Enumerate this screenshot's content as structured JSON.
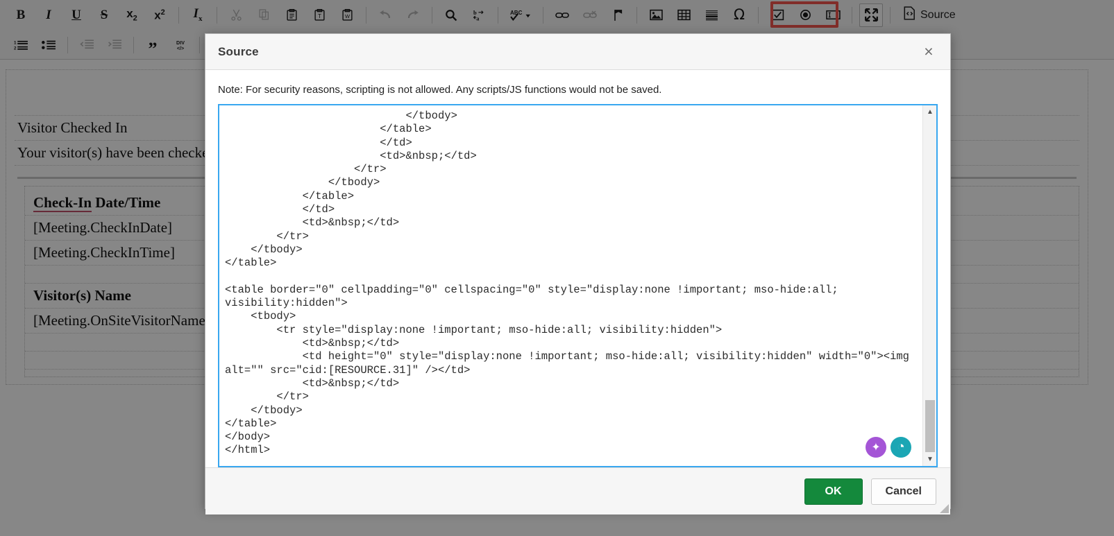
{
  "toolbar": {
    "row1": [
      {
        "name": "bold-icon",
        "glyph": "B",
        "style": "bold-serif",
        "dim": false
      },
      {
        "name": "italic-icon",
        "glyph": "I",
        "style": "italic-serif",
        "dim": false
      },
      {
        "name": "underline-icon",
        "glyph": "U",
        "style": "underline-serif",
        "dim": false
      },
      {
        "name": "strikethrough-icon",
        "glyph": "S",
        "style": "strike-serif",
        "dim": false
      },
      {
        "name": "subscript-icon",
        "glyph": "x₂",
        "style": "plain",
        "dim": false
      },
      {
        "name": "superscript-icon",
        "glyph": "x²",
        "style": "plain",
        "dim": false
      },
      {
        "name": "remove-format-icon",
        "glyph": "Iₓ",
        "style": "italic-serif",
        "dim": false
      },
      {
        "name": "cut-icon",
        "glyph": "✂",
        "style": "plain",
        "dim": true
      },
      {
        "name": "copy-icon",
        "glyph": "❐",
        "style": "plain",
        "dim": true
      },
      {
        "name": "paste-icon",
        "glyph": "Ὄb",
        "style": "plain",
        "dim": false
      },
      {
        "name": "paste-as-text-icon",
        "glyph": "T",
        "style": "boxed",
        "dim": false
      },
      {
        "name": "paste-from-word-icon",
        "glyph": "W",
        "style": "boxed",
        "dim": false
      },
      {
        "name": "undo-icon",
        "glyph": "↶",
        "style": "plain",
        "dim": true
      },
      {
        "name": "redo-icon",
        "glyph": "↷",
        "style": "plain",
        "dim": true
      },
      {
        "name": "find-icon",
        "glyph": "⌕",
        "style": "plain",
        "dim": false
      },
      {
        "name": "replace-icon",
        "glyph": "b→a",
        "style": "plain",
        "dim": false
      },
      {
        "name": "spellcheck-icon",
        "glyph": "ABC✓",
        "style": "plain",
        "dim": false
      },
      {
        "name": "link-icon",
        "glyph": "⚭",
        "style": "plain",
        "dim": false
      },
      {
        "name": "unlink-icon",
        "glyph": "⚭",
        "style": "plain",
        "dim": true
      },
      {
        "name": "anchor-icon",
        "glyph": "⚑",
        "style": "plain",
        "dim": false
      },
      {
        "name": "image-icon",
        "glyph": "Ὓc",
        "style": "plain",
        "dim": false
      },
      {
        "name": "table-icon",
        "glyph": "▦",
        "style": "plain",
        "dim": false
      },
      {
        "name": "horizontal-rule-icon",
        "glyph": "≡",
        "style": "plain",
        "dim": false
      },
      {
        "name": "special-character-icon",
        "glyph": "Ω",
        "style": "plain",
        "dim": false
      },
      {
        "name": "checkbox-icon",
        "glyph": "☑",
        "style": "plain",
        "dim": false
      },
      {
        "name": "radio-button-icon",
        "glyph": "◉",
        "style": "plain",
        "dim": false
      },
      {
        "name": "text-field-icon",
        "glyph": "▢",
        "style": "plain",
        "dim": false
      },
      {
        "name": "maximize-icon",
        "glyph": "⤡",
        "style": "boxed",
        "dim": false
      }
    ],
    "source_button_label": "Source",
    "row2": [
      {
        "name": "numbered-list-icon",
        "glyph": "1.2.",
        "dim": false
      },
      {
        "name": "bulleted-list-icon",
        "glyph": "•≡",
        "dim": false
      },
      {
        "name": "decrease-indent-icon",
        "glyph": "←≡",
        "dim": true
      },
      {
        "name": "increase-indent-icon",
        "glyph": "→≡",
        "dim": true
      },
      {
        "name": "blockquote-icon",
        "glyph": "”",
        "dim": false
      },
      {
        "name": "create-div-icon",
        "glyph": "DIV",
        "dim": false
      },
      {
        "name": "align-left-icon",
        "glyph": "≡",
        "dim": false,
        "active": true
      },
      {
        "name": "align-center-icon",
        "glyph": "≡",
        "dim": false
      }
    ]
  },
  "document": {
    "heading": "Visitor Checked In",
    "subheading": "Your visitor(s) have been checke",
    "table": {
      "col1_header_prefix": "Check-In",
      "col1_header_suffix": " Date/Time",
      "col1_value_1": "[Meeting.CheckInDate]",
      "col1_value_2": "[Meeting.CheckInTime]",
      "col2_header": "Visitor(s) Name",
      "col2_value": "[Meeting.OnSiteVisitorNames]"
    }
  },
  "dialog": {
    "title": "Source",
    "close_label": "×",
    "note": "Note: For security reasons, scripting is not allowed. Any scripts/JS functions would not be saved.",
    "source_code": "                            </tbody>\n                        </table>\n                        </td>\n                        <td>&nbsp;</td>\n                    </tr>\n                </tbody>\n            </table>\n            </td>\n            <td>&nbsp;</td>\n        </tr>\n    </tbody>\n</table>\n\n<table border=\"0\" cellpadding=\"0\" cellspacing=\"0\" style=\"display:none !important; mso-hide:all; visibility:hidden\">\n    <tbody>\n        <tr style=\"display:none !important; mso-hide:all; visibility:hidden\">\n            <td>&nbsp;</td>\n            <td height=\"0\" style=\"display:none !important; mso-hide:all; visibility:hidden\" width=\"0\"><img alt=\"\" src=\"cid:[RESOURCE.31]\" /></td>\n            <td>&nbsp;</td>\n        </tr>\n    </tbody>\n</table>\n</body>\n</html>",
    "scrollbar": {
      "up_arrow": "▲",
      "down_arrow": "▼"
    },
    "ai_sparkle_label": "✦",
    "ai_teal_label": "◔",
    "ok_label": "OK",
    "cancel_label": "Cancel"
  },
  "colors": {
    "highlight_red": "#f4564e",
    "ok_green": "#14893c",
    "textarea_focus_blue": "#38a7f0",
    "ai_purple": "#a455d6",
    "ai_teal": "#1ba6b4"
  }
}
